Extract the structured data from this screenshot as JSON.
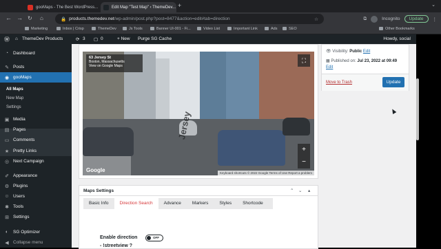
{
  "browser": {
    "tabs": [
      {
        "label": "gooMaps - The Best WordPress...",
        "active": false
      },
      {
        "label": "Edit Map \"Test Map\" ‹ ThemeDev...",
        "active": true
      }
    ],
    "url_host": "products.themedev.net",
    "url_path": "/wp-admin/post.php?post=8477&action=edit#tab=direction",
    "profile_label": "Incognito",
    "update_label": "Update",
    "bookmarks": [
      "Marketing",
      "Inbox | Crisp",
      "ThemeDev",
      "Js Tools",
      "Banner UI-001 - Fi...",
      "Video List",
      "Important Link",
      "Ads",
      "SEO"
    ],
    "other_bookmarks": "Other Bookmarks"
  },
  "adminbar": {
    "site_name": "ThemeDev Products",
    "updates_count": "3",
    "comments_count": "0",
    "new_label": "+ New",
    "purge_label": "Purge SG Cache",
    "howdy": "Howdy, social"
  },
  "sidebar": {
    "items": [
      {
        "label": "Dashboard",
        "icon": "dashboard-icon"
      },
      {
        "label": "Posts",
        "icon": "pin-icon"
      },
      {
        "label": "gooMaps",
        "icon": "map-icon",
        "current": true
      },
      {
        "label": "Media",
        "icon": "media-icon"
      },
      {
        "label": "Pages",
        "icon": "page-icon"
      },
      {
        "label": "Comments",
        "icon": "comment-icon"
      },
      {
        "label": "Pretty Links",
        "icon": "link-icon"
      },
      {
        "label": "Next Campaign",
        "icon": "campaign-icon"
      },
      {
        "label": "Appearance",
        "icon": "brush-icon"
      },
      {
        "label": "Plugins",
        "icon": "plugin-icon"
      },
      {
        "label": "Users",
        "icon": "user-icon"
      },
      {
        "label": "Tools",
        "icon": "wrench-icon"
      },
      {
        "label": "Settings",
        "icon": "settings-icon"
      },
      {
        "label": "SG Optimizer",
        "icon": "optimizer-icon"
      },
      {
        "label": "Collapse menu",
        "icon": "collapse-icon"
      }
    ],
    "submenu": [
      "All Maps",
      "New Map",
      "Settings"
    ]
  },
  "map": {
    "place_title": "63 Jersey St",
    "place_subtitle": "Boston, Massachusetts",
    "view_link": "View on Google Maps",
    "street_label": "Jersey",
    "logo": "Google",
    "attribution": "Keyboard shortcuts   © 2022 Google   Terms of Use   Report a problem"
  },
  "publish": {
    "visibility_label": "Visibility:",
    "visibility_value": "Public",
    "visibility_edit": "Edit",
    "published_label": "Published on:",
    "published_value": "Jul 23, 2022 at 09:49",
    "published_edit": "Edit",
    "trash_label": "Move to Trash",
    "update_label": "Update"
  },
  "settings": {
    "title": "Maps Settings",
    "tabs": [
      "Basic Info",
      "Direction Search",
      "Advance",
      "Markers",
      "Styles",
      "Shortcode"
    ],
    "active_tab": "Direction Search",
    "field_label": "Enable direction",
    "toggle_label": "OFF",
    "field2_label": "- !streetview ?"
  }
}
